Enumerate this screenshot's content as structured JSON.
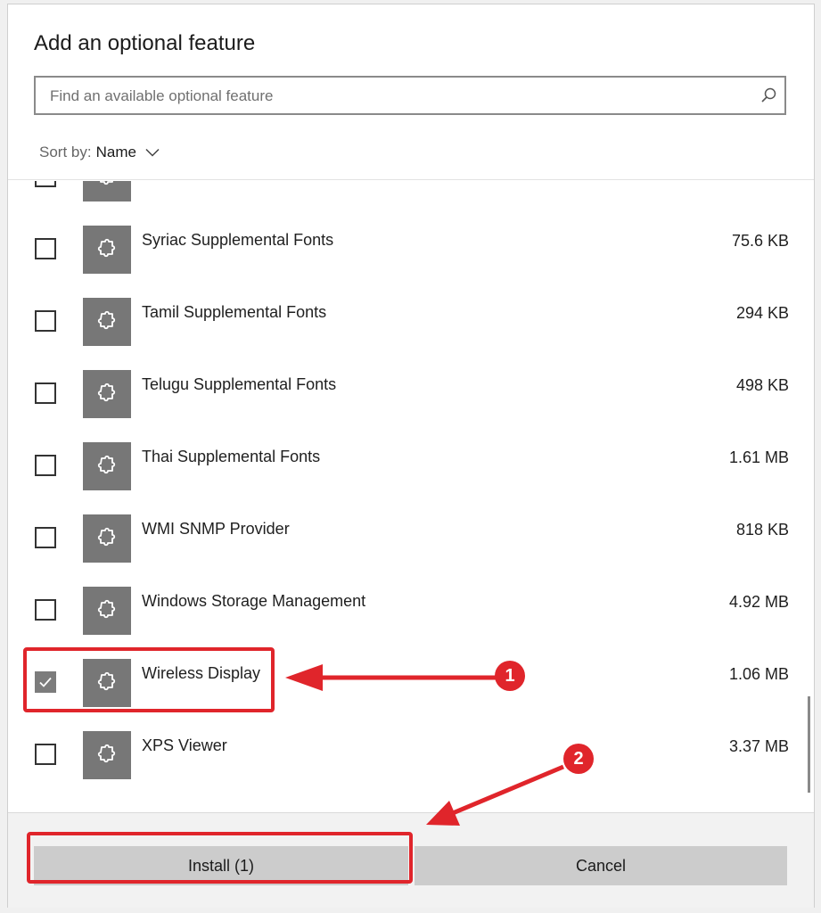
{
  "dialog": {
    "title": "Add an optional feature",
    "search": {
      "placeholder": "Find an available optional feature",
      "value": ""
    },
    "sort": {
      "label": "Sort by:",
      "value": "Name"
    }
  },
  "features": [
    {
      "name": "Syriac Supplemental Fonts",
      "size": "75.6 KB",
      "checked": false
    },
    {
      "name": "Tamil Supplemental Fonts",
      "size": "294 KB",
      "checked": false
    },
    {
      "name": "Telugu Supplemental Fonts",
      "size": "498 KB",
      "checked": false
    },
    {
      "name": "Thai Supplemental Fonts",
      "size": "1.61 MB",
      "checked": false
    },
    {
      "name": "WMI SNMP Provider",
      "size": "818 KB",
      "checked": false
    },
    {
      "name": "Windows Storage Management",
      "size": "4.92 MB",
      "checked": false
    },
    {
      "name": "Wireless Display",
      "size": "1.06 MB",
      "checked": true
    },
    {
      "name": "XPS Viewer",
      "size": "3.37 MB",
      "checked": false
    }
  ],
  "footer": {
    "install_label": "Install (1)",
    "cancel_label": "Cancel"
  },
  "annotations": {
    "step1": "1",
    "step2": "2",
    "color": "#e0252b"
  },
  "icons": {
    "feature": "puzzle-piece-icon",
    "search": "search-icon",
    "sort": "chevron-down-icon"
  },
  "colors": {
    "tile": "#777777",
    "button": "#cccccc"
  }
}
